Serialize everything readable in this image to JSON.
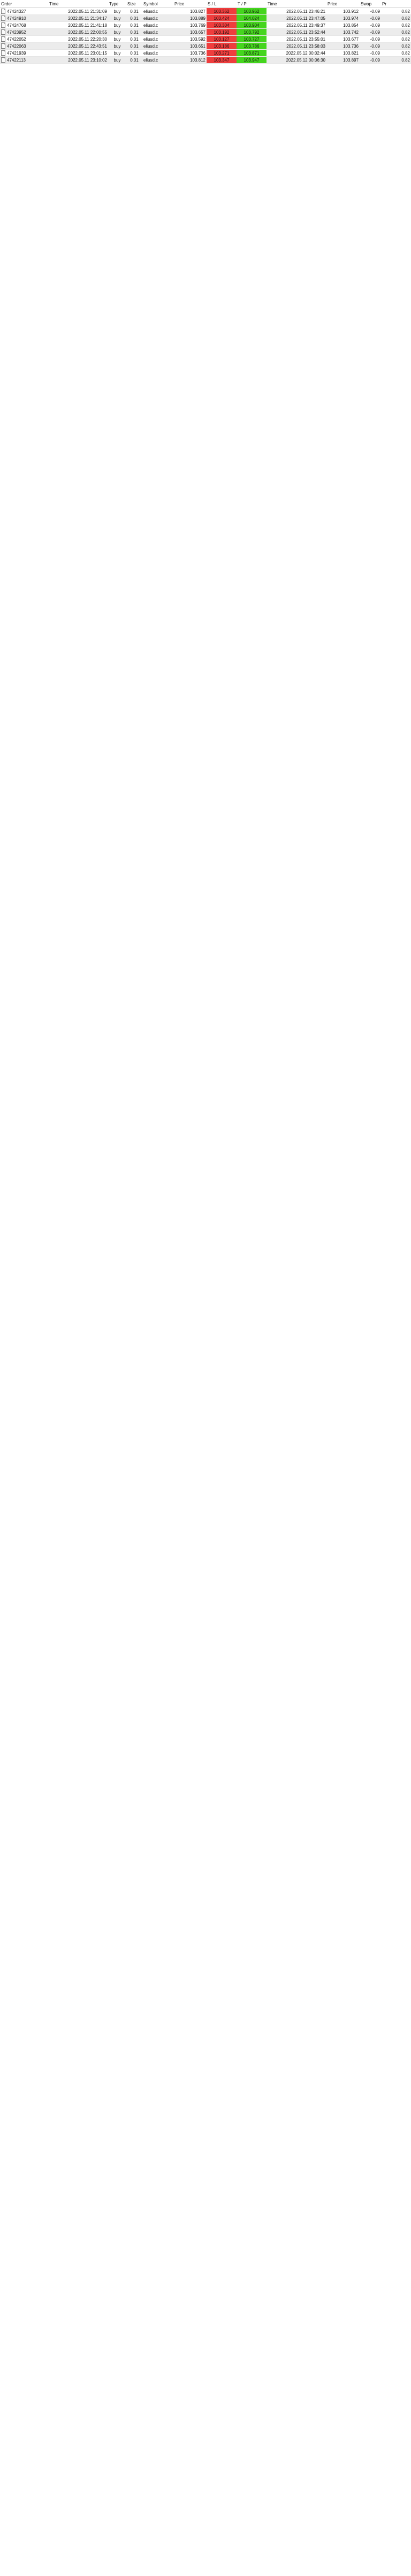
{
  "columns": [
    "Order",
    "Time",
    "Type",
    "Size",
    "Symbol",
    "Price",
    "S / L",
    "T / P",
    "Time",
    "Price",
    "Swap",
    "Pr"
  ],
  "rows": [
    {
      "cells": [
        "47424327",
        "2022.05.11 21:31:09",
        "buy",
        "0.01",
        "eliusd.c",
        "103.827",
        "103.362",
        "103.962",
        "2022.05.11 23:46:21",
        "103.912",
        "-0.09",
        "0.82"
      ]
    },
    {
      "cells": [
        "47424910",
        "2022.05.11 21:34:17",
        "buy",
        "0.01",
        "eliusd.c",
        "103.889",
        "103.424",
        "104.024",
        "2022.05.11 23:47:05",
        "103.974",
        "-0.09",
        "0.82"
      ]
    },
    {
      "cells": [
        "47424768",
        "2022.05.11 21:41:18",
        "buy",
        "0.01",
        "eliusd.c",
        "103.769",
        "103.304",
        "103.904",
        "2022.05.11 23:49:37",
        "103.854",
        "-0.09",
        "0.82"
      ]
    },
    {
      "cells": [
        "47423952",
        "2022.05.11 22:00:55",
        "buy",
        "0.01",
        "eliusd.c",
        "103.657",
        "103.192",
        "103.792",
        "2022.05.11 23:52:44",
        "103.742",
        "-0.09",
        "0.82"
      ]
    },
    {
      "cells": [
        "47422052",
        "2022.05.11 22:20:30",
        "buy",
        "0.01",
        "eliusd.c",
        "103.592",
        "103.127",
        "103.727",
        "2022.05.11 23:55:01",
        "103.677",
        "-0.09",
        "0.82"
      ]
    },
    {
      "cells": [
        "47422063",
        "2022.05.11 22:43:51",
        "buy",
        "0.01",
        "eliusd.c",
        "103.651",
        "103.186",
        "103.786",
        "2022.05.11 23:58:03",
        "103.736",
        "-0.09",
        "0.82"
      ]
    },
    {
      "cells": [
        "47421939",
        "2022.05.11 23:01:15",
        "buy",
        "0.01",
        "eliusd.c",
        "103.736",
        "103.271",
        "103.871",
        "2022.05.12 00:02:44",
        "103.821",
        "-0.09",
        "0.82"
      ]
    },
    {
      "cells": [
        "47422113",
        "2022.05.11 23:10:02",
        "buy",
        "0.01",
        "eliusd.c",
        "103.812",
        "103.347",
        "103.947",
        "2022.05.12 00:06:30",
        "103.897",
        "-0.09",
        "0.82"
      ]
    }
  ]
}
